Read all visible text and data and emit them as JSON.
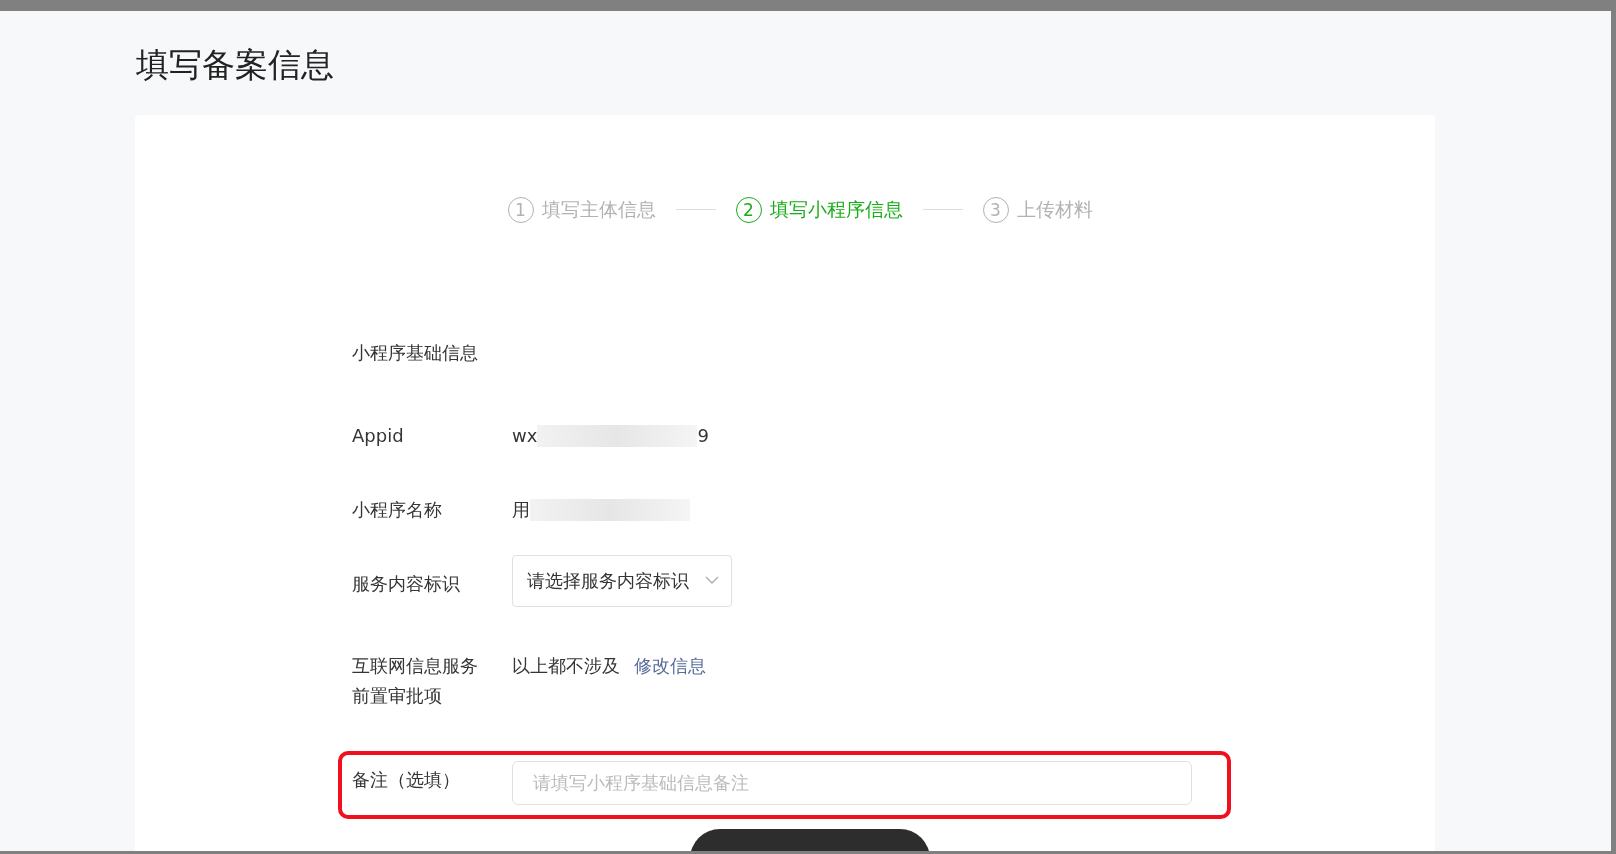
{
  "page_title": "填写备案信息",
  "steps": [
    {
      "number": "1",
      "label": "填写主体信息",
      "selected": false
    },
    {
      "number": "2",
      "label": "填写小程序信息",
      "selected": true
    },
    {
      "number": "3",
      "label": "上传材料",
      "selected": false
    }
  ],
  "section_title": "小程序基础信息",
  "fields": [
    {
      "kind": "text",
      "label": "Appid",
      "value": "wx",
      "value_end": "9",
      "redacted": true
    },
    {
      "kind": "text",
      "label": "小程序名称",
      "value": "用",
      "redacted": true
    },
    {
      "kind": "select",
      "label": "服务内容标识",
      "value": "请选择服务内容标识"
    },
    {
      "kind": "info",
      "label": "互联网信息服务前置审批项",
      "value": "以上都不涉及",
      "link": "修改信息"
    },
    {
      "kind": "input",
      "label": "备注（选填）",
      "placeholder": "请填写小程序基础信息备注",
      "highlighted": true
    }
  ]
}
